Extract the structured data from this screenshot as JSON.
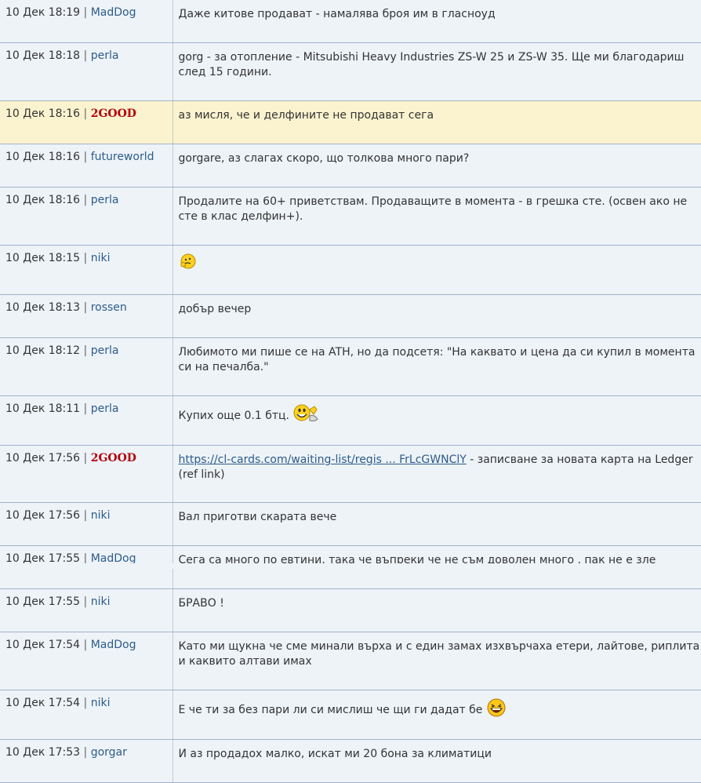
{
  "messages": [
    {
      "time": "10 Дек 18:19",
      "user": "MadDog",
      "vip": false,
      "text": "Даже китове продават - намалява броя им в гласноуд"
    },
    {
      "time": "10 Дек 18:18",
      "user": "perla",
      "vip": false,
      "text": "gorg - за отопление - Mitsubishi Heavy Industries ZS-W 25 и ZS-W 35. Ще ми благодариш след 15 години."
    },
    {
      "time": "10 Дек 18:16",
      "user": "2GOOD",
      "vip": true,
      "text": "аз мисля, че и делфините не продават сега"
    },
    {
      "time": "10 Дек 18:16",
      "user": "futureworld",
      "vip": false,
      "text": "gorgare, аз слагах скоро, що толкова много пари?"
    },
    {
      "time": "10 Дек 18:16",
      "user": "perla",
      "vip": false,
      "text": "Продалите на 60+ приветствам. Продаващите в момента - в грешка сте. (освен ако не сте в клас делфин+)."
    },
    {
      "time": "10 Дек 18:15",
      "user": "niki",
      "vip": false,
      "text": "",
      "emoticon": "thinking-smiley-icon"
    },
    {
      "time": "10 Дек 18:13",
      "user": "rossen",
      "vip": false,
      "text": "добър вечер"
    },
    {
      "time": "10 Дек 18:12",
      "user": "perla",
      "vip": false,
      "text": "Любимото ми пише се на ATH, но да подсетя: \"На каквато и цена да си купил в момента си на печалба.\""
    },
    {
      "time": "10 Дек 18:11",
      "user": "perla",
      "vip": false,
      "text": "Купих още 0.1 бтц.",
      "emoticon": "waving-smiley-icon"
    },
    {
      "time": "10 Дек 17:56",
      "user": "2GOOD",
      "vip": true,
      "link": "https://cl-cards.com/waiting-list/regis ... FrLcGWNClY",
      "text": " - записване за новата карта на Ledger (ref link)"
    },
    {
      "time": "10 Дек 17:56",
      "user": "niki",
      "vip": false,
      "text": "Вал приготви скарата вече"
    },
    {
      "time": "10 Дек 17:55",
      "user": "MadDog",
      "vip": false,
      "text": "Сега са много по евтини, така че въпреки че не съм доволен много , пак не е зле"
    },
    {
      "time": "10 Дек 17:55",
      "user": "niki",
      "vip": false,
      "text": "БРАВО !"
    },
    {
      "time": "10 Дек 17:54",
      "user": "MadDog",
      "vip": false,
      "text": "Като ми щукна че сме минали върха и с един замах изхвърчаха етери, лайтове, риплита и каквито алтави имах"
    },
    {
      "time": "10 Дек 17:54",
      "user": "niki",
      "vip": false,
      "text": "Е че ти за без пари ли си мислиш че щи ги дадат бе",
      "emoticon": "laughing-smiley-icon"
    },
    {
      "time": "10 Дек 17:53",
      "user": "gorgar",
      "vip": false,
      "text": "И аз продадох малко, искат ми 20 бона за климатици"
    }
  ],
  "separator": "|"
}
